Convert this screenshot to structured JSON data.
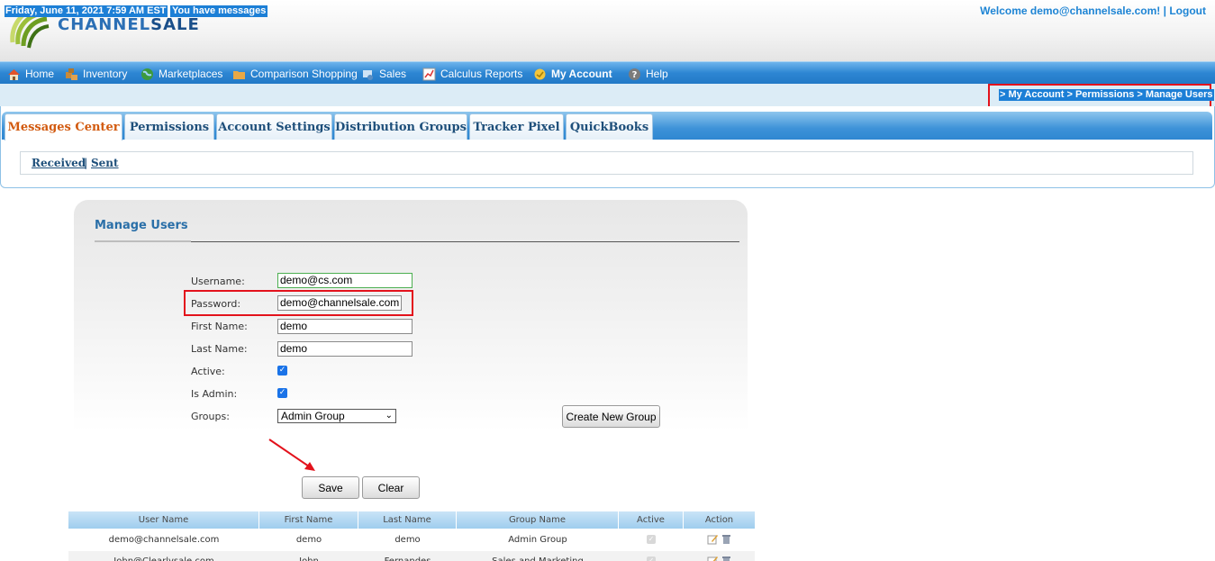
{
  "header": {
    "logo_text_a": "CHANNEL",
    "logo_text_b": "SALE",
    "welcome_text": "Welcome demo@channelsale.com!",
    "separator": "|",
    "logout_label": "Logout"
  },
  "nav": {
    "items": [
      {
        "label": "Home",
        "icon": "home-icon"
      },
      {
        "label": "Inventory",
        "icon": "inventory-icon"
      },
      {
        "label": "Marketplaces",
        "icon": "globe-icon"
      },
      {
        "label": "Comparison Shopping",
        "icon": "folder-icon"
      },
      {
        "label": "Sales",
        "icon": "sales-icon"
      },
      {
        "label": "Calculus Reports",
        "icon": "chart-icon"
      },
      {
        "label": "My Account",
        "icon": "account-icon"
      },
      {
        "label": "Help",
        "icon": "help-icon"
      }
    ]
  },
  "infobar": {
    "date": "Friday, June 11, 2021 7:59 AM EST",
    "messages": "You have messages",
    "breadcrumb": "> My Account > Permissions > Manage Users"
  },
  "tabs": [
    {
      "label": "Messages Center",
      "active": true
    },
    {
      "label": "Permissions",
      "active": false
    },
    {
      "label": "Account Settings",
      "active": false
    },
    {
      "label": "Distribution Groups",
      "active": false
    },
    {
      "label": "Tracker Pixel",
      "active": false
    },
    {
      "label": "QuickBooks",
      "active": false
    }
  ],
  "subnav": {
    "received": "Received",
    "separator": "|",
    "sent": "Sent"
  },
  "form": {
    "title": "Manage Users",
    "username_label": "Username:",
    "username_value": "demo@cs.com",
    "password_label": "Password:",
    "password_value": "demo@channelsale.com",
    "first_name_label": "First Name:",
    "first_name_value": "demo",
    "last_name_label": "Last Name:",
    "last_name_value": "demo",
    "active_label": "Active:",
    "active_checked": true,
    "is_admin_label": "Is Admin:",
    "is_admin_checked": true,
    "groups_label": "Groups:",
    "groups_selected": "Admin Group",
    "create_group_label": "Create New Group",
    "save_label": "Save",
    "clear_label": "Clear"
  },
  "table": {
    "columns": [
      "User Name",
      "First Name",
      "Last Name",
      "Group Name",
      "Active",
      "Action"
    ],
    "rows": [
      {
        "user": "demo@channelsale.com",
        "first": "demo",
        "last": "demo",
        "group": "Admin Group",
        "active": true
      },
      {
        "user": "John@Clearlysale.com",
        "first": "John",
        "last": "Fernandes",
        "group": "Sales and Marketing",
        "active": true
      }
    ]
  },
  "colors": {
    "accent_red": "#e3121c",
    "nav_blue": "#2d86d3",
    "title_blue": "#2a6fa8"
  }
}
